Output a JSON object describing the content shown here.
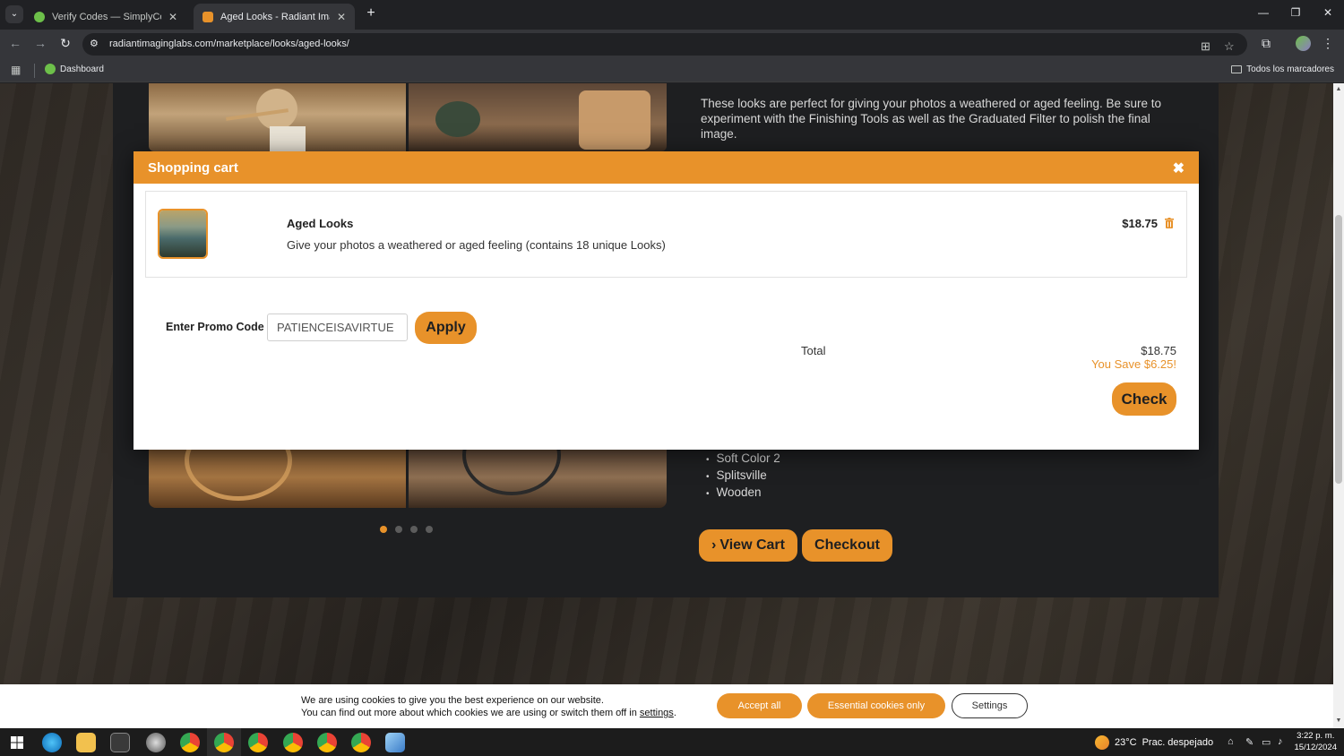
{
  "browser": {
    "tabs": [
      {
        "title": "Verify Codes — SimplyCodes",
        "favicon_color": "#6dc04a",
        "active": false
      },
      {
        "title": "Aged Looks - Radiant Imaging",
        "favicon_color": "#e8922a",
        "active": true
      }
    ],
    "url": "radiantimaginglabs.com/marketplace/looks/aged-looks/",
    "bookmarks": [
      {
        "label": "Dashboard"
      }
    ],
    "all_bookmarks_label": "Todos los marcadores"
  },
  "page": {
    "description": "These looks are perfect for giving your photos a weathered or aged feeling. Be sure to experiment with the Finishing Tools as well as the Graduated Filter to polish the final image.",
    "looks_list": [
      "Soft Color 2",
      "Splitsville",
      "Wooden"
    ],
    "carousel_active_index": 0,
    "view_cart_label": "View Cart",
    "checkout_label": "Checkout"
  },
  "cart": {
    "title": "Shopping cart",
    "item": {
      "name": "Aged Looks",
      "description": "Give your photos a weathered or aged feeling (contains 18 unique Looks)",
      "price": "$18.75"
    },
    "promo_label": "Enter Promo Code",
    "promo_value": "PATIENCEISAVIRTUE",
    "apply_label": "Apply",
    "total_label": "Total",
    "total_value": "$18.75",
    "savings": "You Save $6.25!",
    "check_label": "Check"
  },
  "cookies": {
    "line1": "We are using cookies to give you the best experience on our website.",
    "line2_prefix": "You can find out more about which cookies we are using or switch them off in",
    "settings_link": "settings",
    "line2_suffix": ".",
    "accept_all": "Accept all",
    "essential_only": "Essential cookies only",
    "settings_button": "Settings"
  },
  "taskbar": {
    "temperature": "23°C",
    "weather": "Prac. despejado",
    "time": "3:22 p. m.",
    "date": "15/12/2024"
  },
  "colors": {
    "accent": "#e8922a",
    "page_bg": "#1e1f21"
  }
}
